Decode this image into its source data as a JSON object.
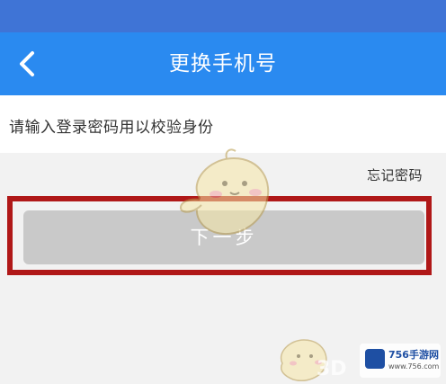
{
  "header": {
    "title": "更换手机号",
    "back_icon": "chevron-left-icon"
  },
  "prompt": {
    "text": "请输入登录密码用以校验身份"
  },
  "forgot_password": {
    "label": "忘记密码"
  },
  "next_button": {
    "label": "下一步"
  },
  "watermark": {
    "site_title": "756手游网",
    "site_url": "www.756.com",
    "mark_3d": "3D"
  },
  "colors": {
    "status_bar": "#3f74d6",
    "header": "#2a8af0",
    "button_disabled": "#c9c9c9",
    "highlight_border": "#b01818"
  }
}
